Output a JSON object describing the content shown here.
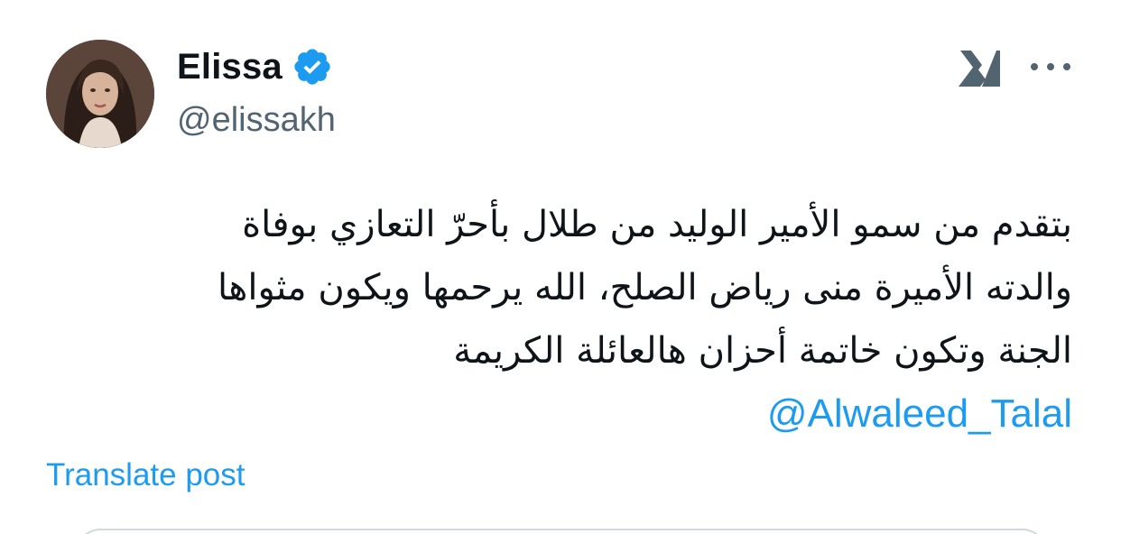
{
  "author": {
    "display_name": "Elissa",
    "handle": "@elissakh",
    "verified": true
  },
  "tweet": {
    "lines": [
      "بتقدم من سمو الأمير الوليد من طلال بأحرّ التعازي بوفاة",
      "والدته الأميرة منى رياض الصلح، الله يرحمها ويكون مثواها",
      "الجنة وتكون خاتمة أحزان هالعائلة الكريمة"
    ],
    "mention": "@Alwaleed_Talal"
  },
  "actions": {
    "translate_label": "Translate post"
  },
  "icons": {
    "verified": "verified-badge-icon",
    "grok": "grok-icon",
    "more": "more-options-icon"
  },
  "colors": {
    "accent": "#1d9bf0",
    "text": "#0f1419",
    "secondary": "#536471"
  }
}
